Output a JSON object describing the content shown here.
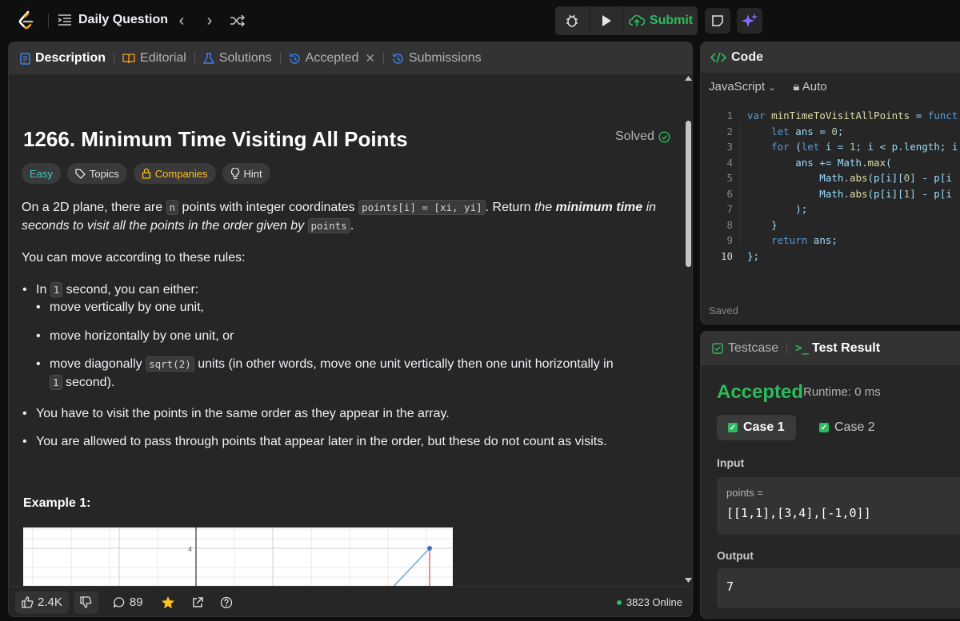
{
  "topbar": {
    "daily_question": "Daily Question",
    "submit": "Submit"
  },
  "tabs": [
    {
      "label": "Description"
    },
    {
      "label": "Editorial"
    },
    {
      "label": "Solutions"
    },
    {
      "label": "Accepted"
    },
    {
      "label": "Submissions"
    }
  ],
  "problem": {
    "title": "1266. Minimum Time Visiting All Points",
    "status": "Solved",
    "difficulty": "Easy",
    "topics": "Topics",
    "companies": "Companies",
    "hint": "Hint",
    "p1_a": "On a 2D plane, there are ",
    "p1_n": "n",
    "p1_b": " points with integer coordinates ",
    "p1_code": "points[i] = [xi, yi]",
    "p1_c": ". Return ",
    "p1_em1": "the ",
    "p1_strong": "minimum time",
    "p1_em2": " in seconds to visit all the points in the order given by ",
    "p1_code2": "points",
    "p1_d": ".",
    "p2": "You can move according to these rules:",
    "b1_a": "In ",
    "b1_code": "1",
    "b1_b": " second, you can either:",
    "s1": "move vertically by one unit,",
    "s2": "move horizontally by one unit, or",
    "s3_a": "move diagonally ",
    "s3_code": "sqrt(2)",
    "s3_b": " units (in other words, move one unit vertically then one unit horizontally in ",
    "s3_code2": "1",
    "s3_c": " second).",
    "b2": "You have to visit the points in the same order as they appear in the array.",
    "b3": "You are allowed to pass through points that appear later in the order, but these do not count as visits.",
    "example_title": "Example 1:",
    "graph_tick": "4"
  },
  "footer": {
    "likes": "2.4K",
    "comments": "89",
    "online": "3823 Online"
  },
  "code_panel": {
    "title": "Code",
    "language": "JavaScript",
    "mode": "Auto",
    "saved": "Saved",
    "lines": [
      "var minTimeToVisitAllPoints = funct",
      "    let ans = 0;",
      "    for (let i = 1; i < p.length; i",
      "        ans += Math.max(",
      "            Math.abs(p[i][0] - p[i",
      "            Math.abs(p[i][1] - p[i",
      "        );",
      "    }",
      "    return ans;",
      "};"
    ]
  },
  "test_panel": {
    "testcase_tab": "Testcase",
    "result_tab": "Test Result",
    "verdict": "Accepted",
    "runtime": "Runtime: 0 ms",
    "case1": "Case 1",
    "case2": "Case 2",
    "input_label": "Input",
    "input_name": "points =",
    "input_value": "[[1,1],[3,4],[-1,0]]",
    "output_label": "Output",
    "output_value": "7"
  },
  "colors": {
    "accent_green": "#2cbb5d",
    "easy": "#46c6c2",
    "companies": "#ffc01e",
    "star": "#ffc01e",
    "info_blue": "#3b82f6"
  }
}
